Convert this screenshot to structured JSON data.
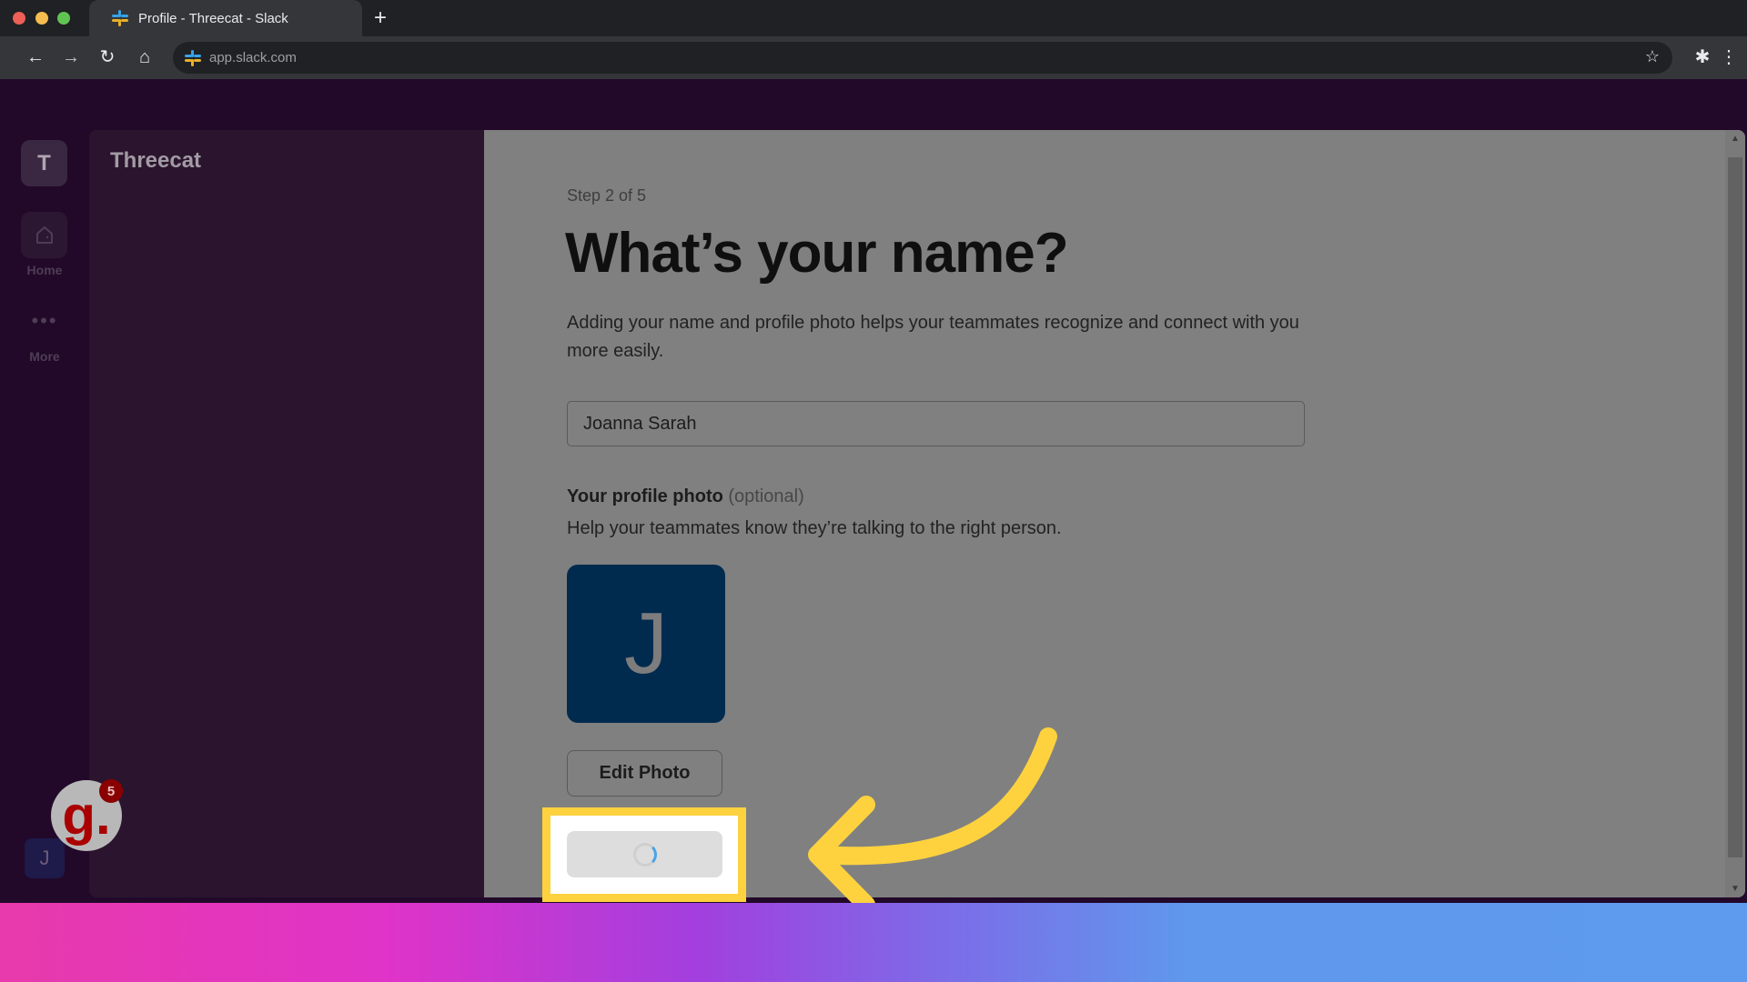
{
  "browser": {
    "tab_title": "Profile - Threecat - Slack",
    "new_tab_label": "+",
    "url": "app.slack.com",
    "nav": {
      "back": "←",
      "forward": "→",
      "reload": "↻",
      "home": "⌂"
    },
    "star": "☆",
    "extensions": "✱",
    "menu": "⋮"
  },
  "rail": {
    "workspace_initial": "T",
    "home_label": "Home",
    "more_dots": "•••",
    "more_label": "More",
    "user_initial": "J"
  },
  "sidebar": {
    "workspace_name": "Threecat"
  },
  "main": {
    "step": "Step 2 of 5",
    "title": "What’s your name?",
    "description": "Adding your name and profile photo helps your teammates recognize and connect with you more easily.",
    "name_value": "Joanna Sarah",
    "photo_label": "Your profile photo",
    "photo_optional": "(optional)",
    "photo_help": "Help your teammates know they’re talking to the right person.",
    "avatar_initial": "J",
    "avatar_color": "#002b4e",
    "edit_photo_label": "Edit Photo",
    "continue_state": "loading"
  },
  "overlay": {
    "highlight_color": "#fdd23e",
    "widget_letter": "g.",
    "widget_badge_count": "5"
  }
}
